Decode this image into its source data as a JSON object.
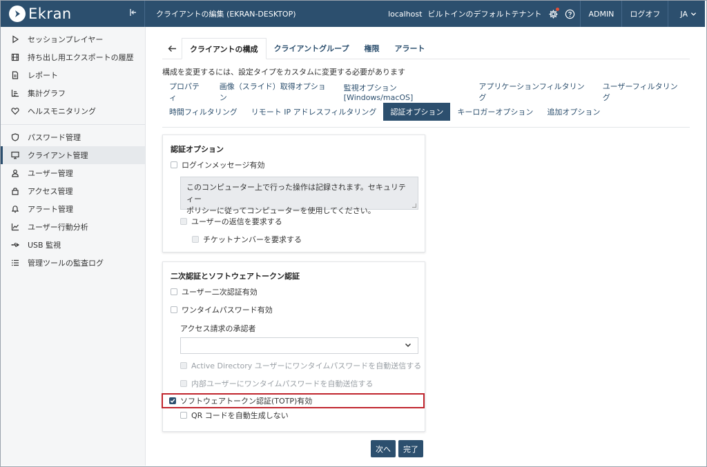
{
  "header": {
    "logo_text": "Ekran",
    "page_title": "クライアントの編集 (EKRAN-DESKTOP)",
    "host": "localhost",
    "tenant": "ビルトインのデフォルトテナント",
    "admin_label": "ADMIN",
    "logoff_label": "ログオフ",
    "lang_label": "JA"
  },
  "sidebar": {
    "items": [
      {
        "label": "セッションプレイヤー",
        "icon": "play-icon"
      },
      {
        "label": "持ち出し用エクスポートの履歴",
        "icon": "film-icon"
      },
      {
        "label": "レポート",
        "icon": "document-icon"
      },
      {
        "label": "集計グラフ",
        "icon": "bar-chart-icon"
      },
      {
        "label": "ヘルスモニタリング",
        "icon": "heart-icon"
      },
      {
        "label": "パスワード管理",
        "icon": "shield-icon"
      },
      {
        "label": "クライアント管理",
        "icon": "monitor-icon"
      },
      {
        "label": "ユーザー管理",
        "icon": "user-icon"
      },
      {
        "label": "アクセス管理",
        "icon": "lock-icon"
      },
      {
        "label": "アラート管理",
        "icon": "bell-icon"
      },
      {
        "label": "ユーザー行動分析",
        "icon": "line-chart-icon"
      },
      {
        "label": "USB 監視",
        "icon": "usb-icon"
      },
      {
        "label": "管理ツールの監査ログ",
        "icon": "list-icon"
      }
    ]
  },
  "tabs": {
    "items": [
      "クライアントの構成",
      "クライアントグループ",
      "権限",
      "アラート"
    ]
  },
  "notice": "構成を変更するには、設定タイプをカスタムに変更する必要があります",
  "subtabs": {
    "row1": [
      "プロパティ",
      "画像（スライド）取得オプション",
      "監視オプション [Windows/macOS]",
      "アプリケーションフィルタリング",
      "ユーザーフィルタリング"
    ],
    "row2": [
      "時間フィルタリング",
      "リモート IP アドレスフィルタリング",
      "認証オプション",
      "キーロガーオプション",
      "追加オプション"
    ]
  },
  "auth_card": {
    "title": "認証オプション",
    "login_message_enabled": "ログインメッセージ有効",
    "message_line1": "このコンピューター上で行った操作は記録されます。セキュリティー",
    "message_line2": "ポリシーに従ってコンピューターを使用してください。",
    "require_reply": "ユーザーの返信を要求する",
    "require_ticket": "チケットナンバーを要求する"
  },
  "twofa_card": {
    "title": "二次認証とソフトウェアトークン認証",
    "user_2fa": "ユーザー二次認証有効",
    "otp_enabled": "ワンタイムパスワード有効",
    "approver_label": "アクセス請求の承認者",
    "approver_value": "",
    "ad_auto_send": "Active Directory ユーザーにワンタイムパスワードを自動送信する",
    "internal_auto_send": "内部ユーザーにワンタイムパスワードを自動送信する",
    "totp_enabled": "ソフトウェアトークン認証(TOTP)有効",
    "qr_no_auto": "QR コードを自動生成しない"
  },
  "buttons": {
    "next": "次へ",
    "finish": "完了"
  },
  "colors": {
    "brand": "#2c4f6e",
    "highlight": "#c0242c"
  }
}
